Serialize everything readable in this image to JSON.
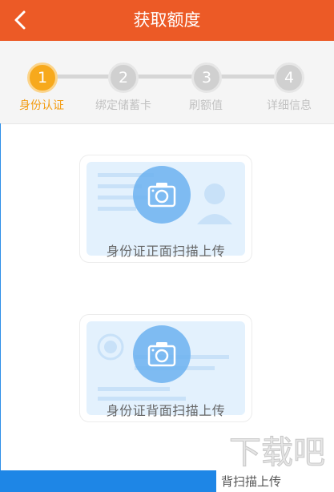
{
  "header": {
    "title": "获取额度",
    "back_icon": "chevron-left-icon",
    "background": "#ec5a26"
  },
  "stepper": {
    "steps": [
      {
        "number": "1",
        "label": "身份认证",
        "active": true
      },
      {
        "number": "2",
        "label": "绑定储蓄卡",
        "active": false
      },
      {
        "number": "3",
        "label": "刷额值",
        "active": false
      },
      {
        "number": "4",
        "label": "详细信息",
        "active": false
      }
    ],
    "active_color": "#f7a91c",
    "inactive_color": "#d0d0d0"
  },
  "upload": {
    "front": {
      "caption": "身份证正面扫描上传",
      "icon": "camera-icon"
    },
    "back": {
      "caption": "身份证背面扫描上传",
      "icon": "camera-icon"
    }
  },
  "bottom": {
    "partial_text": "背扫描上传",
    "bar_color": "#1e86e6"
  },
  "watermark": {
    "text": "下载吧"
  }
}
